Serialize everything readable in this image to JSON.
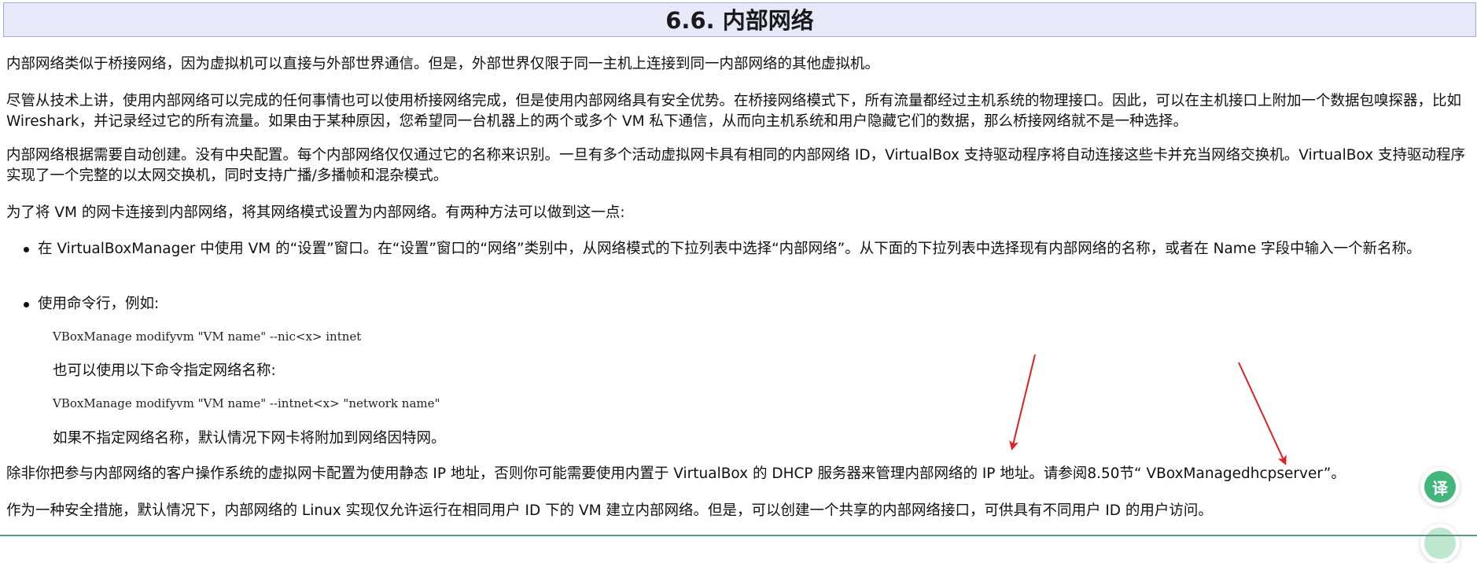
{
  "section": {
    "title": "6.6. 内部网络"
  },
  "paragraphs": {
    "p1": "内部网络类似于桥接网络，因为虚拟机可以直接与外部世界通信。但是，外部世界仅限于同一主机上连接到同一内部网络的其他虚拟机。",
    "p2": "尽管从技术上讲，使用内部网络可以完成的任何事情也可以使用桥接网络完成，但是使用内部网络具有安全优势。在桥接网络模式下，所有流量都经过主机系统的物理接口。因此，可以在主机接口上附加一个数据包嗅探器，比如 Wireshark，并记录经过它的所有流量。如果由于某种原因，您希望同一台机器上的两个或多个 VM 私下通信，从而向主机系统和用户隐藏它们的数据，那么桥接网络就不是一种选择。",
    "p3": "内部网络根据需要自动创建。没有中央配置。每个内部网络仅仅通过它的名称来识别。一旦有多个活动虚拟网卡具有相同的内部网络 ID，VirtualBox 支持驱动程序将自动连接这些卡并充当网络交换机。VirtualBox 支持驱动程序实现了一个完整的以太网交换机，同时支持广播/多播帧和混杂模式。",
    "p4": "为了将 VM 的网卡连接到内部网络，将其网络模式设置为内部网络。有两种方法可以做到这一点:",
    "p5": "除非你把参与内部网络的客户操作系统的虚拟网卡配置为使用静态 IP 地址，否则你可能需要使用内置于 VirtualBox 的 DHCP 服务器来管理内部网络的 IP 地址。请参阅8.50节“ VBoxManagedhcpserver”。",
    "p6": "作为一种安全措施，默认情况下，内部网络的 Linux 实现仅允许运行在相同用户 ID 下的 VM 建立内部网络。但是，可以创建一个共享的内部网络接口，可供具有不同用户 ID 的用户访问。"
  },
  "bullets": {
    "b1": "在 VirtualBoxManager 中使用 VM 的“设置”窗口。在“设置”窗口的“网络”类别中，从网络模式的下拉列表中选择“内部网络”。从下面的下拉列表中选择现有内部网络的名称，或者在 Name 字段中输入一个新名称。",
    "b2": "使用命令行，例如:",
    "code1": "VBoxManage modifyvm \"VM name\" --nic<x> intnet",
    "note1": "也可以使用以下命令指定网络名称:",
    "code2": "VBoxManage modifyvm \"VM name\" --intnet<x> \"network name\"",
    "note2": "如果不指定网络名称，默认情况下网卡将附加到网络因特网。"
  },
  "widgets": {
    "translate_label": "译",
    "translate_icon": "translate-icon",
    "accent_color": "#43b67c",
    "arrow_color": "#e02020"
  }
}
